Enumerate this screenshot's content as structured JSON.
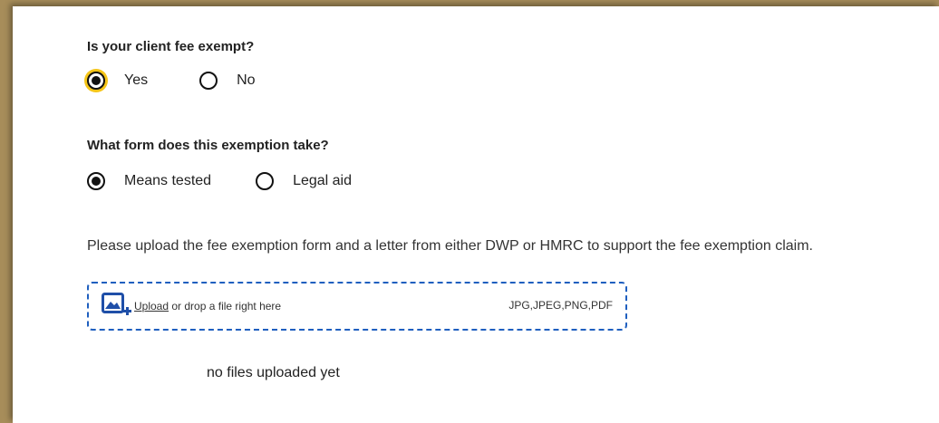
{
  "fee_exempt": {
    "question": "Is your client fee exempt?",
    "options": [
      {
        "label": "Yes",
        "selected": true
      },
      {
        "label": "No",
        "selected": false
      }
    ]
  },
  "exemption_form": {
    "question": "What form does this exemption take?",
    "options": [
      {
        "label": "Means tested",
        "selected": true
      },
      {
        "label": "Legal aid",
        "selected": false
      }
    ]
  },
  "upload": {
    "instruction": "Please upload the fee exemption form and a letter from either DWP or HMRC to support the fee exemption claim.",
    "link_label": "Upload",
    "drop_text": " or drop a file right here",
    "file_types": "JPG,JPEG,PNG,PDF",
    "empty_message": "no files uploaded yet"
  },
  "colors": {
    "frame": "#a78d5a",
    "focus_ring": "#f5c518",
    "dropzone_border": "#1f5fbf",
    "icon": "#1f4fa8"
  },
  "icons": {
    "upload": "image-add-icon"
  }
}
